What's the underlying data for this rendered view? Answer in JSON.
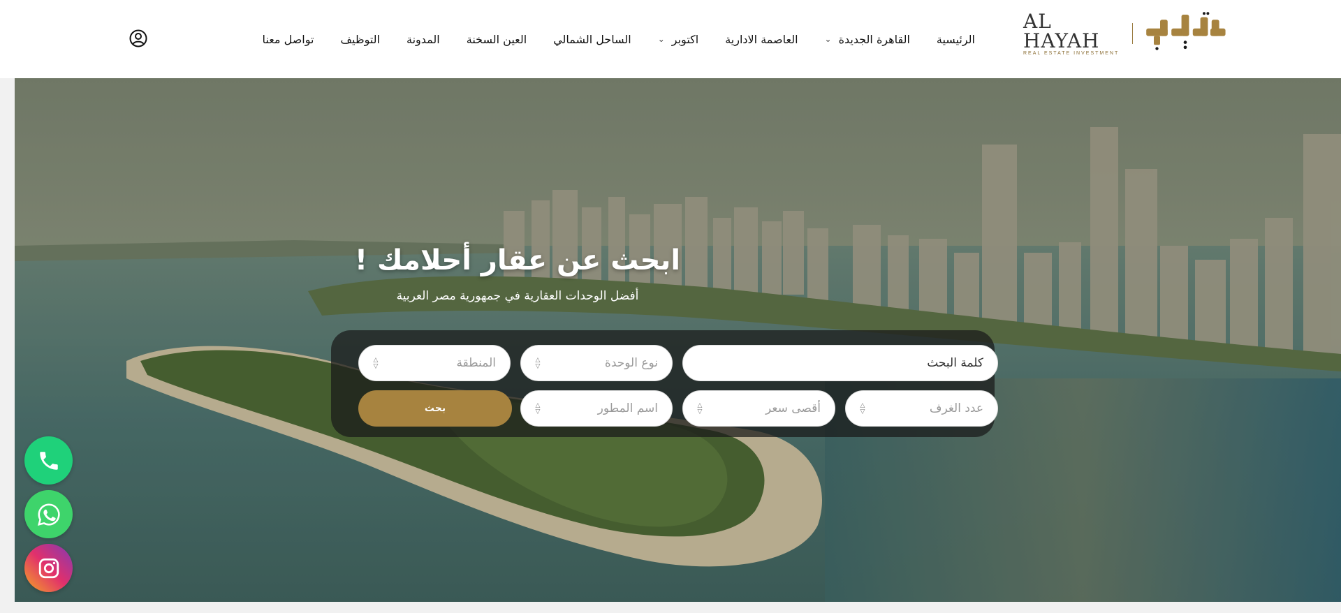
{
  "brand": {
    "name_en": "AL HAYAH",
    "tagline": "REAL ESTATE INVESTMENT",
    "accent": "#a7833f"
  },
  "nav": {
    "items": [
      {
        "label": "الرئيسية",
        "has_dropdown": false
      },
      {
        "label": "القاهرة الجديدة",
        "has_dropdown": true
      },
      {
        "label": "العاصمة الادارية",
        "has_dropdown": false
      },
      {
        "label": "اكتوبر",
        "has_dropdown": true
      },
      {
        "label": "الساحل الشمالي",
        "has_dropdown": false
      },
      {
        "label": "العين السخنة",
        "has_dropdown": false
      },
      {
        "label": "المدونة",
        "has_dropdown": false
      },
      {
        "label": "التوظيف",
        "has_dropdown": false
      },
      {
        "label": "تواصل معنا",
        "has_dropdown": false
      }
    ],
    "account_icon": "user-circle-icon"
  },
  "hero": {
    "title": "ابحث عن عقار أحلامك !",
    "subtitle": "أفضل الوحدات العقارية في جمهورية مصر العربية"
  },
  "search": {
    "keyword_placeholder": "كلمة البحث",
    "unit_type": "نوع الوحدة",
    "area": "المنطقة",
    "rooms": "عدد الغرف",
    "max_price": "أقصى سعر",
    "developer": "اسم المطور",
    "submit_label": "بحث"
  },
  "floating": {
    "phone_icon": "phone-icon",
    "whatsapp_icon": "whatsapp-icon",
    "instagram_icon": "instagram-icon"
  }
}
